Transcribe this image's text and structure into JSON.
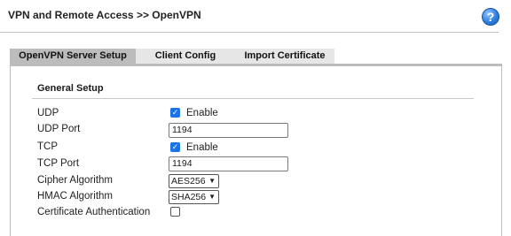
{
  "header": {
    "title": "VPN and Remote Access >> OpenVPN",
    "help_icon": "?"
  },
  "tabs": [
    {
      "label": "OpenVPN Server Setup",
      "active": true
    },
    {
      "label": "Client Config",
      "active": false
    },
    {
      "label": "Import Certificate",
      "active": false
    }
  ],
  "general": {
    "title": "General Setup",
    "udp": {
      "label": "UDP",
      "checked": true,
      "option": "Enable"
    },
    "udp_port": {
      "label": "UDP Port",
      "value": "1194"
    },
    "tcp": {
      "label": "TCP",
      "checked": true,
      "option": "Enable"
    },
    "tcp_port": {
      "label": "TCP Port",
      "value": "1194"
    },
    "cipher": {
      "label": "Cipher Algorithm",
      "value": "AES256"
    },
    "hmac": {
      "label": "HMAC Algorithm",
      "value": "SHA256"
    },
    "cert_auth": {
      "label": "Certificate Authentication",
      "checked": false
    }
  },
  "colors": {
    "accent": "#1a73e8",
    "active_tab": "#bcbcbc",
    "tab": "#e6e6e6"
  }
}
